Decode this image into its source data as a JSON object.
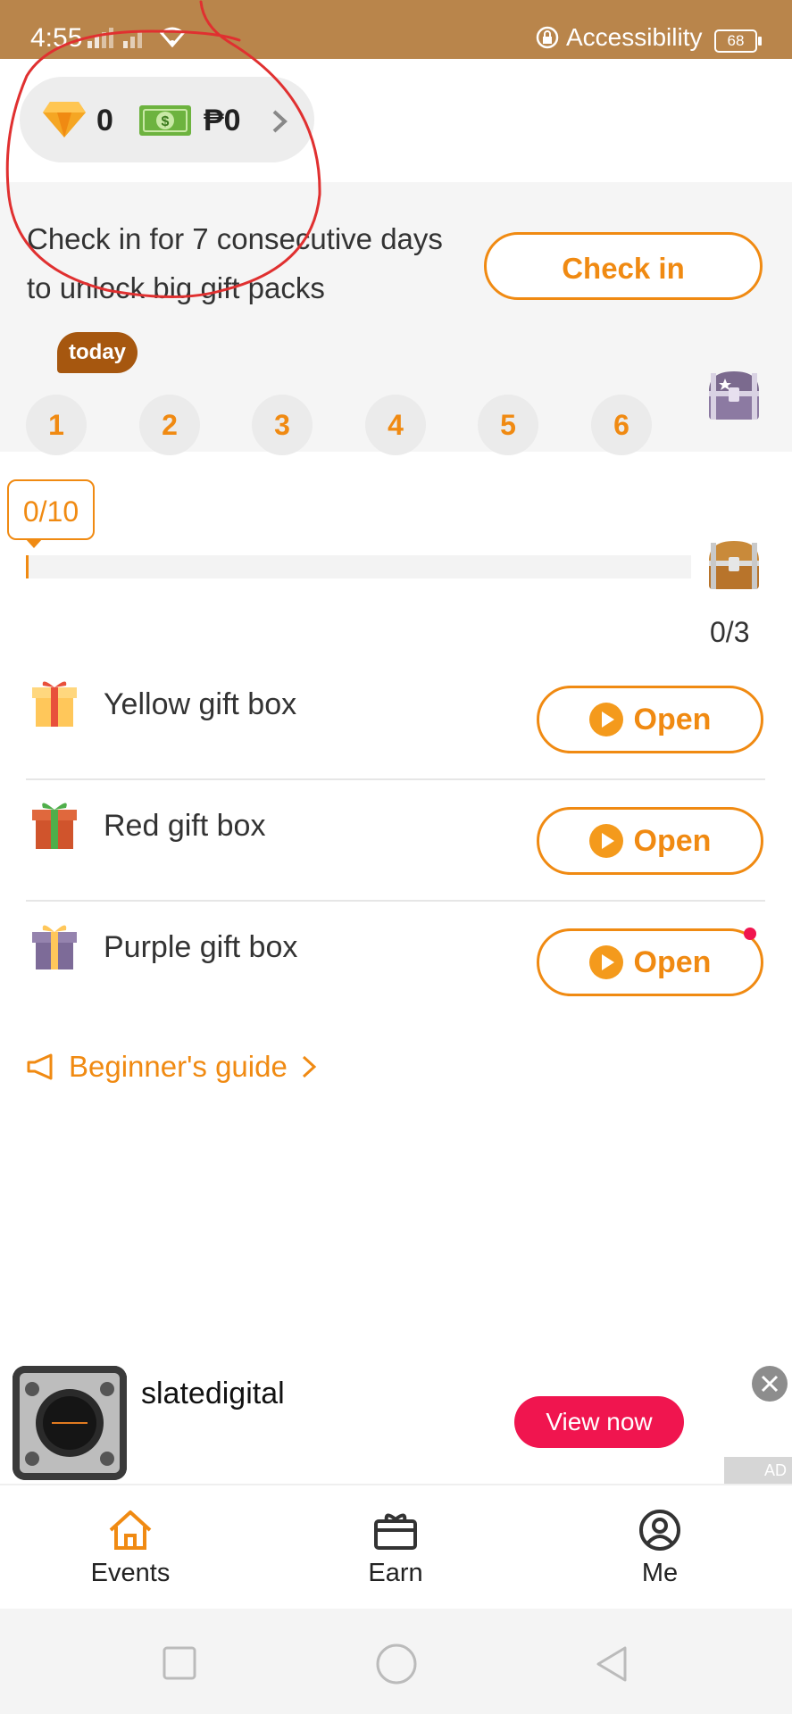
{
  "status_bar": {
    "time": "4:55",
    "accessibility_label": "Accessibility",
    "battery": "68",
    "background_color": "#b9854b"
  },
  "wallet": {
    "diamond_count": "0",
    "cash_amount": "₱0",
    "icons": [
      "diamond-icon",
      "cash-icon",
      "chevron-right-icon"
    ]
  },
  "checkin": {
    "text": "Check in for 7 consecutive days to unlock big gift packs",
    "button_label": "Check in",
    "today_badge": "today",
    "days": [
      "1",
      "2",
      "3",
      "4",
      "5",
      "6"
    ],
    "final_reward_icon": "treasure-chest-icon"
  },
  "progress": {
    "tag": "0/10",
    "current": 0,
    "total": 10,
    "count": "0/3"
  },
  "gifts": [
    {
      "label": "Yellow gift box",
      "button": "Open",
      "icon": "yellow-gift-icon"
    },
    {
      "label": "Red gift box",
      "button": "Open",
      "icon": "red-gift-icon"
    },
    {
      "label": "Purple gift box",
      "button": "Open",
      "icon": "purple-gift-icon"
    }
  ],
  "guide": {
    "label": "Beginner's guide"
  },
  "ad": {
    "app_name": "slatedigital",
    "cta": "View now",
    "tag": "AD"
  },
  "bottom_nav": {
    "items": [
      {
        "label": "Events",
        "icon": "home-icon",
        "active": true
      },
      {
        "label": "Earn",
        "icon": "gift-box-icon",
        "active": false
      },
      {
        "label": "Me",
        "icon": "profile-icon",
        "active": false
      }
    ]
  },
  "colors": {
    "accent": "#f08a12",
    "badge": "#a6570f",
    "cta": "#f0154f",
    "annotation": "#e03030"
  }
}
